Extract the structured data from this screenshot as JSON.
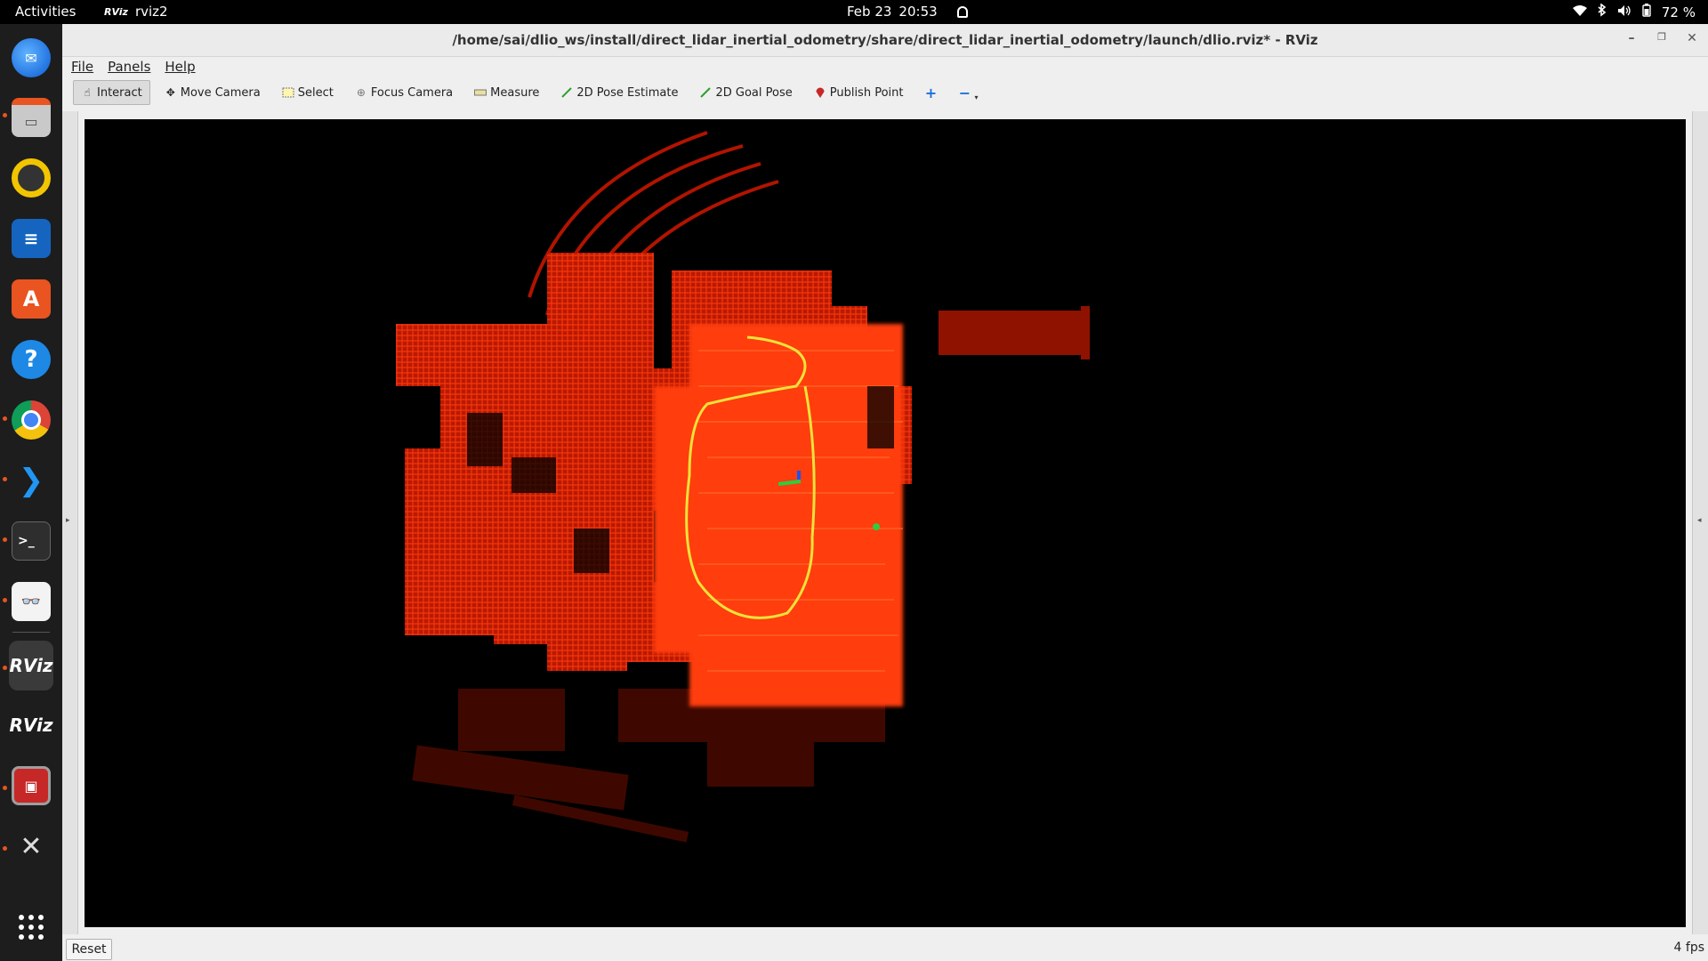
{
  "topbar": {
    "activities": "Activities",
    "app_name": "rviz2",
    "app_badge": "RViz",
    "date": "Feb 23",
    "time": "20:53",
    "battery": "72 %"
  },
  "dock": {
    "items": [
      "thunderbird-icon",
      "files-icon",
      "rhythmbox-icon",
      "writer-icon",
      "app-center-icon",
      "help-icon",
      "chrome-icon",
      "vscode-icon",
      "terminal-icon",
      "document-viewer-icon",
      "rviz-icon",
      "rviz-icon",
      "app-red-icon",
      "tools-icon"
    ],
    "rviz_label": "RViz"
  },
  "window": {
    "title": "/home/sai/dlio_ws/install/direct_lidar_inertial_odometry/share/direct_lidar_inertial_odometry/launch/dlio.rviz* - RViz"
  },
  "menu": {
    "file": "File",
    "panels": "Panels",
    "help": "Help"
  },
  "toolbar": {
    "interact": "Interact",
    "move_camera": "Move Camera",
    "select": "Select",
    "focus_camera": "Focus Camera",
    "measure": "Measure",
    "pose_estimate": "2D Pose Estimate",
    "goal_pose": "2D Goal Pose",
    "publish_point": "Publish Point"
  },
  "colors": {
    "pointcloud": "#ff2a00",
    "pointcloud_dark": "#b81800",
    "trajectory": "#f4e23a",
    "accent": "#e95420"
  },
  "status": {
    "reset": "Reset",
    "fps": "4 fps"
  }
}
